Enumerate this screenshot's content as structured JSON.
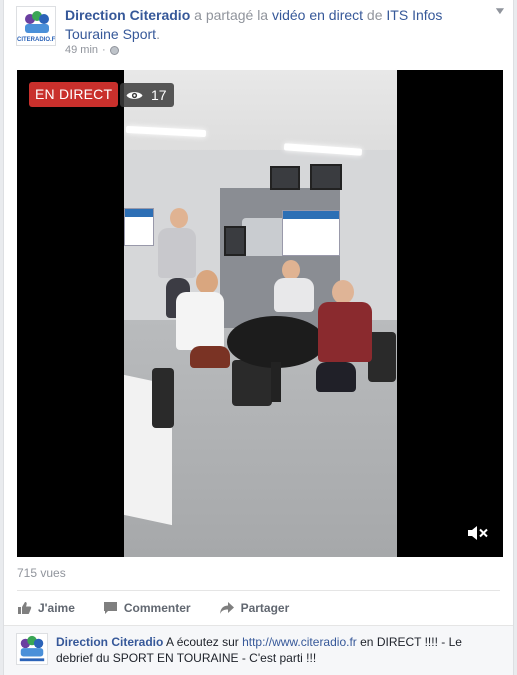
{
  "post": {
    "author": "Direction Citeradio",
    "action_text": " a partagé la ",
    "shared_item": "vidéo en direct",
    "preposition": " de ",
    "source_page": "ITS Infos Touraine Sport",
    "period": ".",
    "time": "49 min",
    "time_separator": "·",
    "avatar_text": "CITERADIO.FR",
    "menu_icon": "chevron-down-icon"
  },
  "video": {
    "live_label": "EN DIRECT",
    "viewer_count": "17",
    "viewer_icon": "eye-icon",
    "mute_icon": "mute-icon",
    "live_color": "#c9302c"
  },
  "stats": {
    "views": "715 vues"
  },
  "actions": {
    "like": "J'aime",
    "comment": "Commenter",
    "share": "Partager"
  },
  "comment": {
    "author": "Direction Citeradio",
    "text_before": " A écoutez sur ",
    "link": "http://www.citeradio.fr",
    "text_after": " en DIRECT !!!! - Le debrief du SPORT EN TOURAINE - C'est parti !!!"
  },
  "colors": {
    "link": "#365899",
    "muted": "#90949c",
    "action": "#616770"
  }
}
